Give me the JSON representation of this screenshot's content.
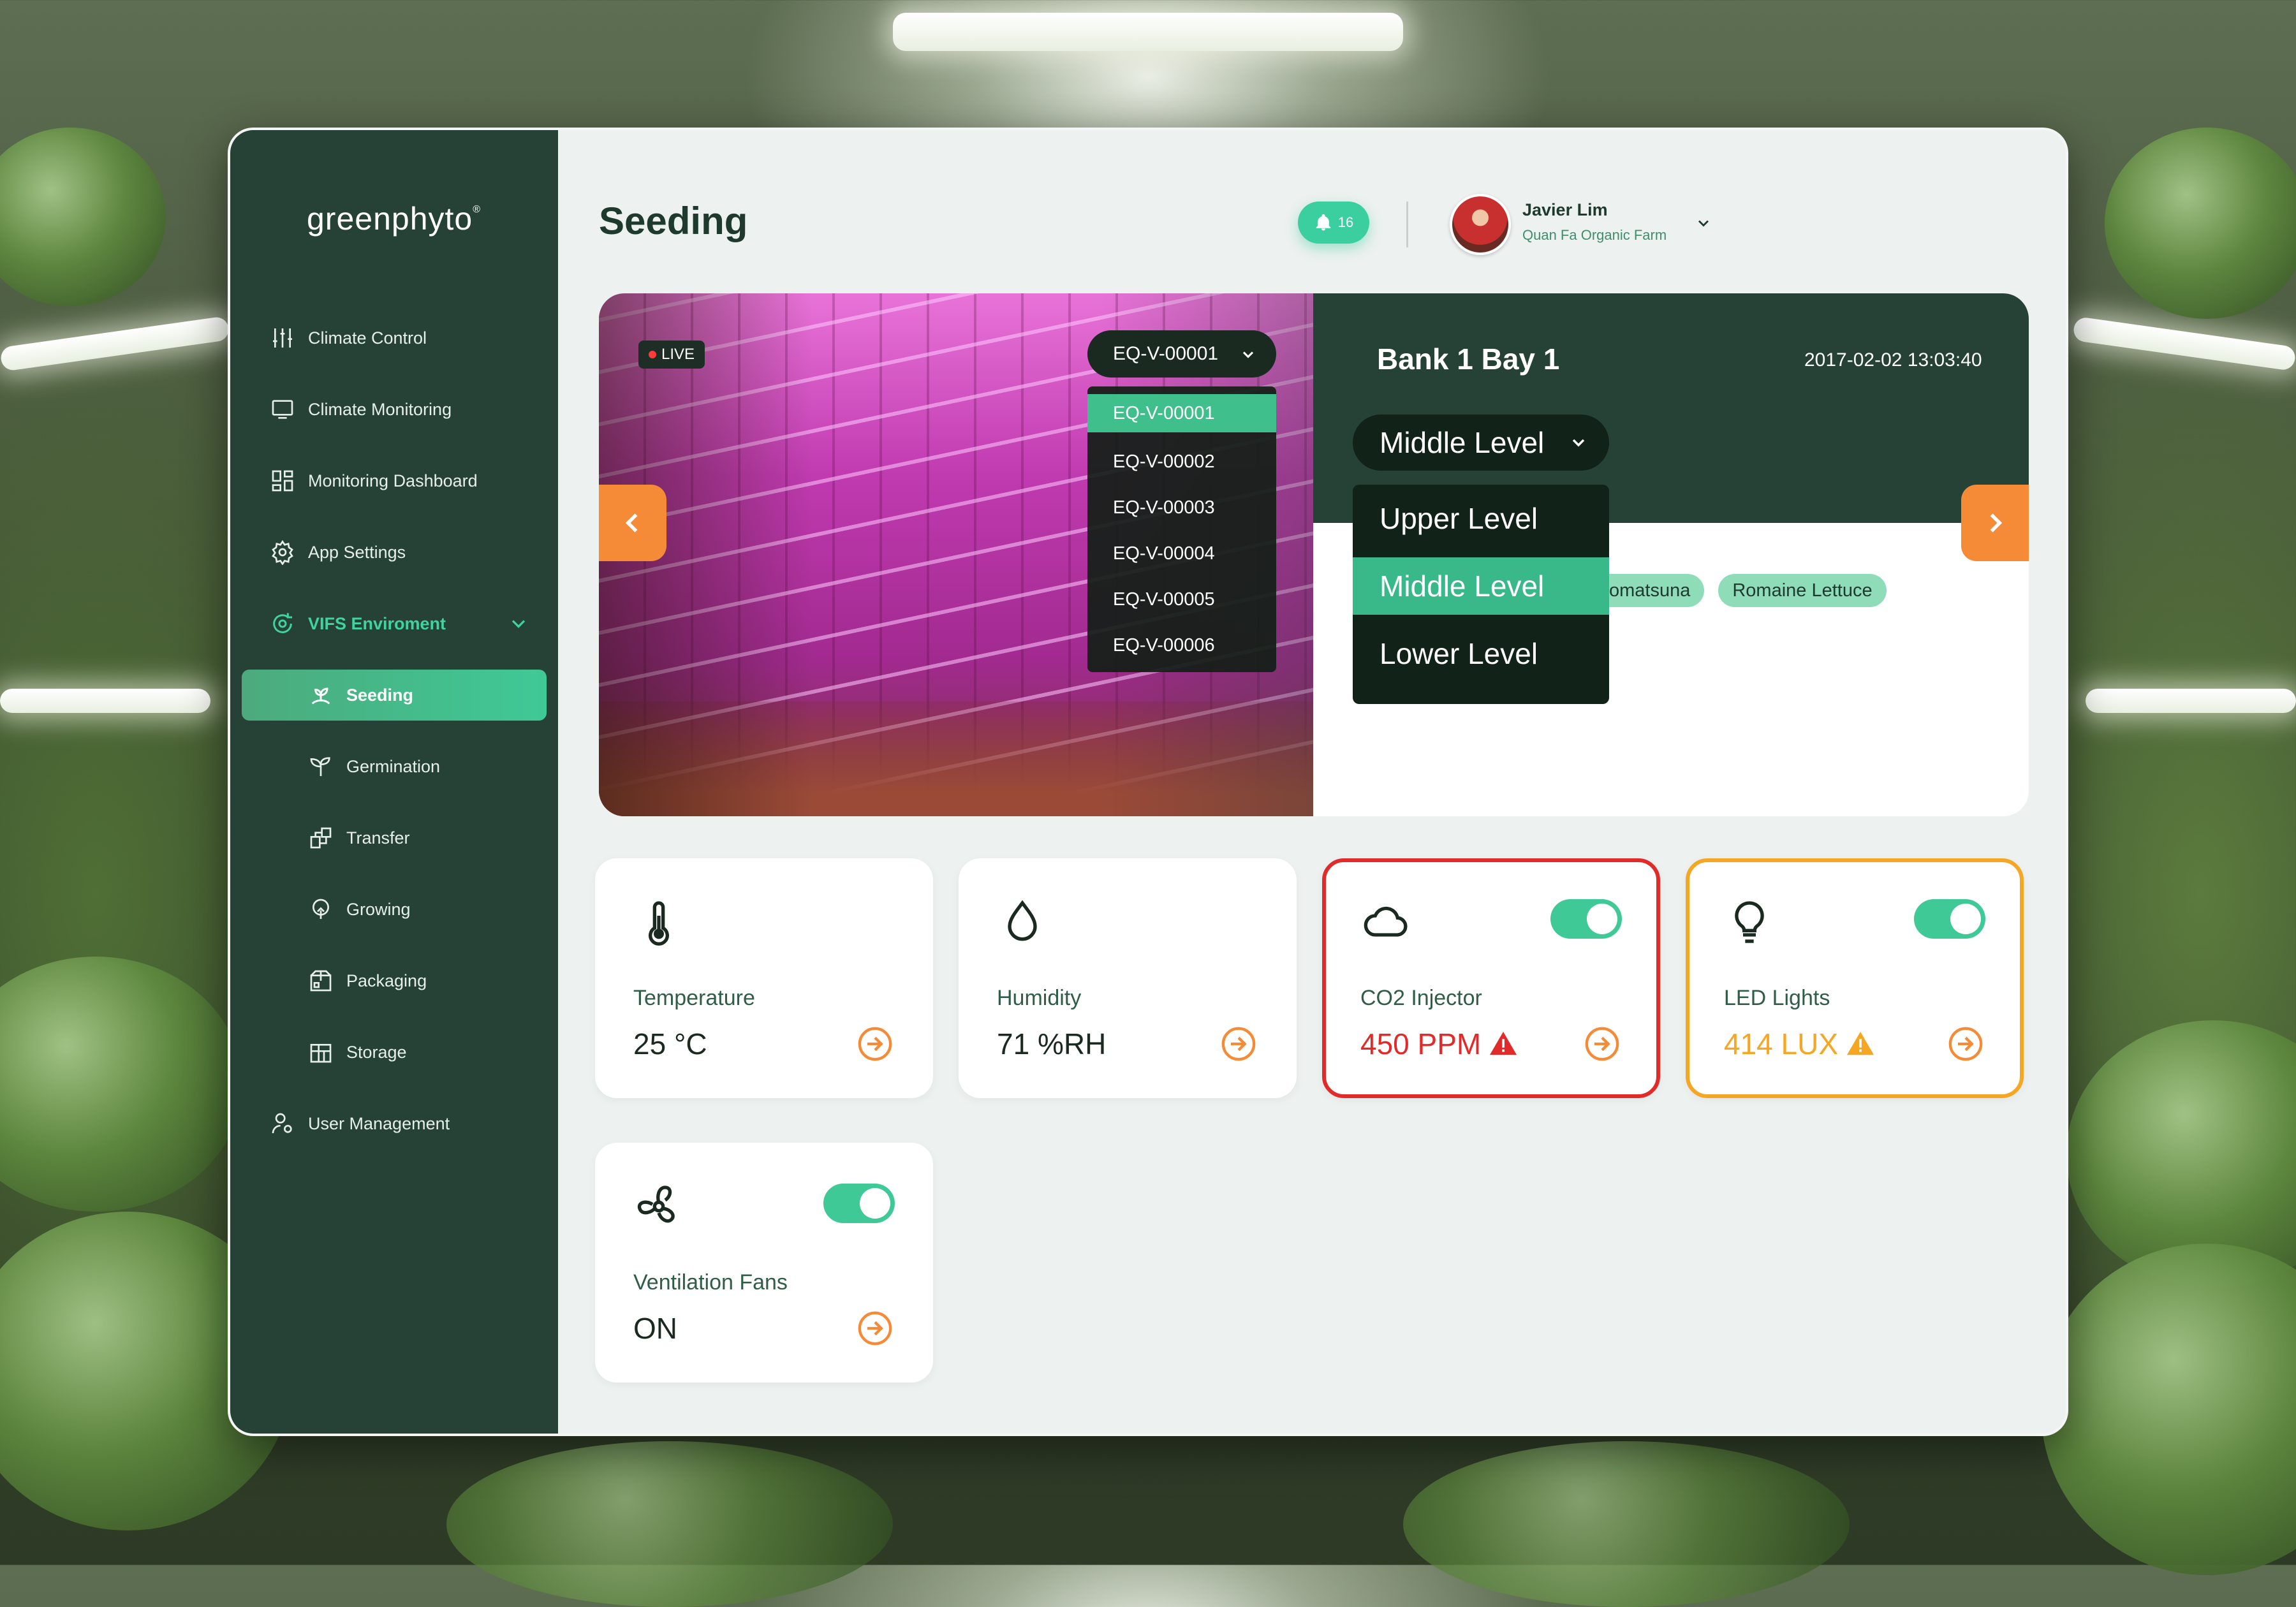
{
  "sidebar": {
    "logo": "greenphyto",
    "logo_mark": "®",
    "items": [
      {
        "label": "Climate Control",
        "icon": "sliders-icon"
      },
      {
        "label": "Climate Monitoring",
        "icon": "monitor-icon"
      },
      {
        "label": "Monitoring Dashboard",
        "icon": "dashboard-icon"
      },
      {
        "label": "App Settings",
        "icon": "gear-icon"
      },
      {
        "label": "VIFS Enviroment",
        "icon": "cycle-icon",
        "expanded": true
      },
      {
        "label": "Seeding",
        "icon": "seed-icon",
        "active": true
      },
      {
        "label": "Germination",
        "icon": "sprout-icon"
      },
      {
        "label": "Transfer",
        "icon": "transfer-icon"
      },
      {
        "label": "Growing",
        "icon": "growing-icon"
      },
      {
        "label": "Packaging",
        "icon": "package-icon"
      },
      {
        "label": "Storage",
        "icon": "storage-icon"
      },
      {
        "label": "User Management",
        "icon": "user-gear-icon"
      }
    ]
  },
  "header": {
    "title": "Seeding",
    "notifications": "16",
    "user_name": "Javier Lim",
    "user_farm": "Quan Fa Organic Farm"
  },
  "camera": {
    "live_label": "LIVE",
    "selected_equipment": "EQ-V-00001",
    "equipment_options": [
      "EQ-V-00001",
      "EQ-V-00002",
      "EQ-V-00003",
      "EQ-V-00004",
      "EQ-V-00005",
      "EQ-V-00006"
    ]
  },
  "bay": {
    "title": "Bank 1 Bay 1",
    "timestamp": "2017-02-02 13:03:40",
    "selected_level": "Middle Level",
    "level_options": [
      "Upper Level",
      "Middle Level",
      "Lower Level"
    ],
    "tags": [
      "Komatsuna",
      "Romaine Lettuce"
    ],
    "tag_visible_first": "omatsuna"
  },
  "cards": {
    "temperature": {
      "label": "Temperature",
      "value": "25 °C"
    },
    "humidity": {
      "label": "Humidity",
      "value": "71 %RH"
    },
    "co2": {
      "label": "CO2 Injector",
      "value": "450 PPM",
      "toggle_on": true,
      "status": "alert"
    },
    "led": {
      "label": "LED Lights",
      "value": "414 LUX",
      "toggle_on": true,
      "status": "warning"
    },
    "fans": {
      "label": "Ventilation Fans",
      "value": "ON",
      "toggle_on": true
    }
  },
  "colors": {
    "sidebar": "#264236",
    "accent": "#3fc996",
    "orange": "#f58a37",
    "alert_red": "#e12b2b",
    "warning_orange": "#f5a623"
  }
}
